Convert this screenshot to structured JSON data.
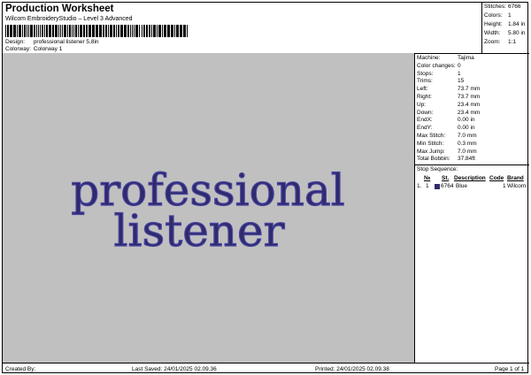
{
  "header": {
    "title": "Production Worksheet",
    "subtitle": "Wilcom EmbroideryStudio – Level 3 Advanced",
    "design_label": "Design:",
    "design_value": "professional listener 5,8in",
    "colorway_label": "Colorway:",
    "colorway_value": "Colorway 1"
  },
  "stats": {
    "stitches_label": "Stitches:",
    "stitches_value": "6766",
    "colors_label": "Colors:",
    "colors_value": "1",
    "height_label": "Height:",
    "height_value": "1.84 in",
    "width_label": "Width:",
    "width_value": "5.80 in",
    "zoom_label": "Zoom:",
    "zoom_value": "1:1"
  },
  "design": {
    "line1": "professional",
    "line2": "listener",
    "thread_color": "#2e2a6b",
    "outline_color": "#4a44a0",
    "canvas_color": "#c0c0c0"
  },
  "machine": [
    {
      "label": "Machine:",
      "value": "Tajima"
    },
    {
      "label": "Color changes:",
      "value": "0"
    },
    {
      "label": "Stops:",
      "value": "1"
    },
    {
      "label": "Trims:",
      "value": "15"
    },
    {
      "label": "Left:",
      "value": "73.7 mm"
    },
    {
      "label": "Right:",
      "value": "73.7 mm"
    },
    {
      "label": "Up:",
      "value": "23.4 mm"
    },
    {
      "label": "Down:",
      "value": "23.4 mm"
    },
    {
      "label": "EndX:",
      "value": "0.00 in"
    },
    {
      "label": "EndY:",
      "value": "0.00 in"
    },
    {
      "label": "Max Stitch:",
      "value": "7.0 mm"
    },
    {
      "label": "Min Stitch:",
      "value": "0.3 mm"
    },
    {
      "label": "Max Jump:",
      "value": "7.0 mm"
    },
    {
      "label": "Total Bobbin:",
      "value": "37.84ft"
    }
  ],
  "stop_sequence": {
    "title": "Stop Sequence:",
    "columns": [
      "№",
      "St.",
      "Description",
      "Code",
      "Brand"
    ],
    "rows": [
      {
        "seq": "1.",
        "num": "1",
        "stitches": "6764",
        "description": "Blue",
        "code": "1",
        "brand": "Wilcom"
      }
    ]
  },
  "footer": {
    "created": "Created By:",
    "last_saved": "Last Saved: 24/01/2025 02.09.36",
    "printed": "Printed: 24/01/2025 02.09.38",
    "page": "Page 1 of 1"
  }
}
